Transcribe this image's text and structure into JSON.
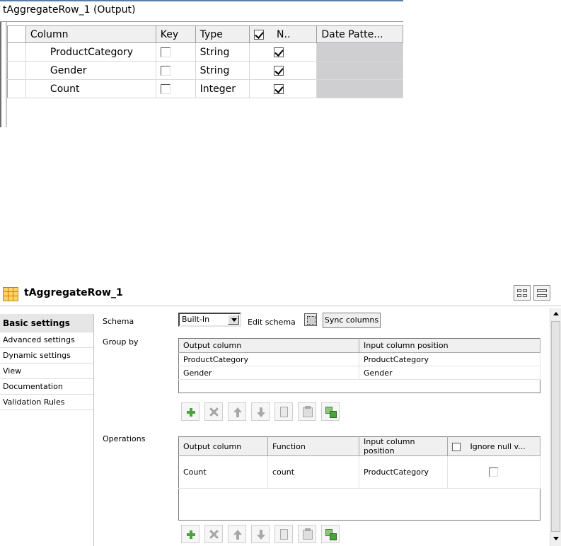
{
  "schema_panel": {
    "title": "tAggregateRow_1 (Output)",
    "columns": [
      "Column",
      "Key",
      "Type",
      "N..",
      "Date Patte..."
    ],
    "rows": [
      {
        "column": "ProductCategory",
        "key": false,
        "type": "String",
        "nullable": true
      },
      {
        "column": "Gender",
        "key": false,
        "type": "String",
        "nullable": true
      },
      {
        "column": "Count",
        "key": false,
        "type": "Integer",
        "nullable": true
      }
    ]
  },
  "component": {
    "title": "tAggregateRow_1",
    "icon": "grid-icon",
    "view_toggles": [
      "tile-view-icon",
      "stack-view-icon"
    ]
  },
  "tabs": [
    {
      "label": "Basic settings",
      "active": true
    },
    {
      "label": "Advanced settings",
      "active": false
    },
    {
      "label": "Dynamic settings",
      "active": false
    },
    {
      "label": "View",
      "active": false
    },
    {
      "label": "Documentation",
      "active": false
    },
    {
      "label": "Validation Rules",
      "active": false
    }
  ],
  "settings": {
    "schema_label": "Schema",
    "schema_value": "Built-In",
    "edit_schema_label": "Edit schema",
    "sync_columns_label": "Sync columns",
    "group_by_label": "Group by",
    "operations_label": "Operations"
  },
  "group_by": {
    "columns": [
      "Output column",
      "Input column position"
    ],
    "rows": [
      [
        "ProductCategory",
        "ProductCategory"
      ],
      [
        "Gender",
        "Gender"
      ]
    ]
  },
  "operations": {
    "columns": [
      "Output column",
      "Function",
      "Input column position",
      "Ignore null v..."
    ],
    "rows": [
      {
        "output": "Count",
        "function": "count",
        "input": "ProductCategory",
        "ignore_null": false
      }
    ]
  },
  "toolbar_icons": [
    "add-icon",
    "remove-icon",
    "move-up-icon",
    "move-down-icon",
    "copy-icon",
    "paste-icon",
    "duplicate-icon"
  ]
}
